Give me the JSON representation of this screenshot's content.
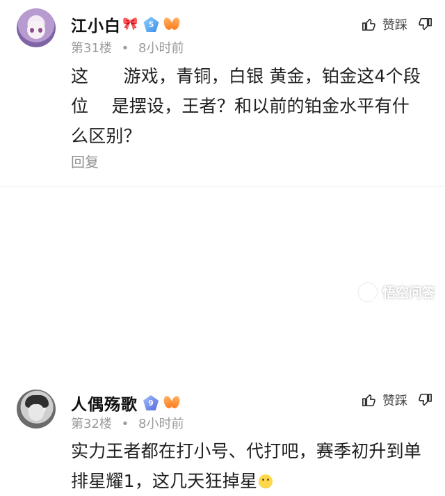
{
  "comments": [
    {
      "user": "江小白",
      "level": "5",
      "floor_meta": "第31楼",
      "time": "8小时前",
      "like_label": "赞踩",
      "content_lines": [
        "这　　游戏，青铜，白银 黄金，铂金这4个段",
        "位　 是摆设，王者？和以前的铂金水平有什",
        "么区别？"
      ],
      "reply_label": "回复"
    },
    {
      "user": "人偶殇歌",
      "level": "9",
      "floor_meta": "第32楼",
      "time": "8小时前",
      "like_label": "赞踩",
      "content_lines": [
        "实力王者都在打小号、代打吧，赛季初升到单",
        "排星耀1，这几天狂掉星"
      ]
    }
  ],
  "watermark": {
    "text": "悟空问答"
  },
  "icons": {
    "bow": "bow-icon",
    "level": "level-badge-icon",
    "lungs": "lungs-icon",
    "thumb_up": "thumb-up-icon",
    "thumb_down": "thumb-down-icon",
    "emoji": "sweat-smile-icon",
    "logo": "search-logo-icon"
  },
  "colors": {
    "meta_gray": "#9a9a9a",
    "text_dark": "#1f1f1f",
    "reply_gray": "#8f8f8f",
    "badge_blue": "#3f8ee9",
    "badge_orange": "#ff7b1c"
  }
}
